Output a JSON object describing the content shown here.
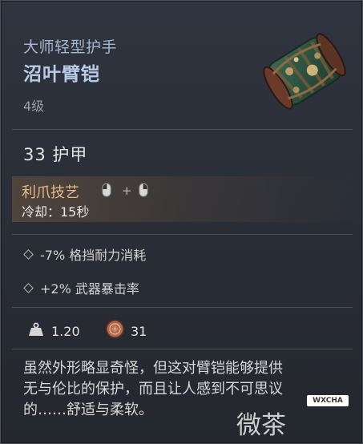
{
  "item": {
    "category": "大师轻型护手",
    "name": "沼叶臂铠",
    "level": "4级",
    "armor": "33 护甲"
  },
  "skill": {
    "name": "利爪技艺",
    "plus": "+",
    "cooldown": "冷却：15秒"
  },
  "stats": [
    {
      "text": "-7% 格挡耐力消耗"
    },
    {
      "text": "+2% 武器暴击率"
    }
  ],
  "meta": {
    "weight": "1.20",
    "value": "31"
  },
  "description": [
    "虽然外形略显奇怪，但这对臂铠能够提供",
    "无与伦比的保护，而且让人感到不可思议",
    "的……舒适与柔软。"
  ],
  "watermark": {
    "badge": "WXCHA",
    "text": "微茶"
  },
  "colors": {
    "title": "#b9cbe6",
    "skill": "#e6b988",
    "background": "#2c3039"
  },
  "icons": [
    "gauntlet-image",
    "mouse-left-icon",
    "mouse-right-icon",
    "diamond-bullet-icon",
    "weight-icon",
    "coin-icon"
  ]
}
